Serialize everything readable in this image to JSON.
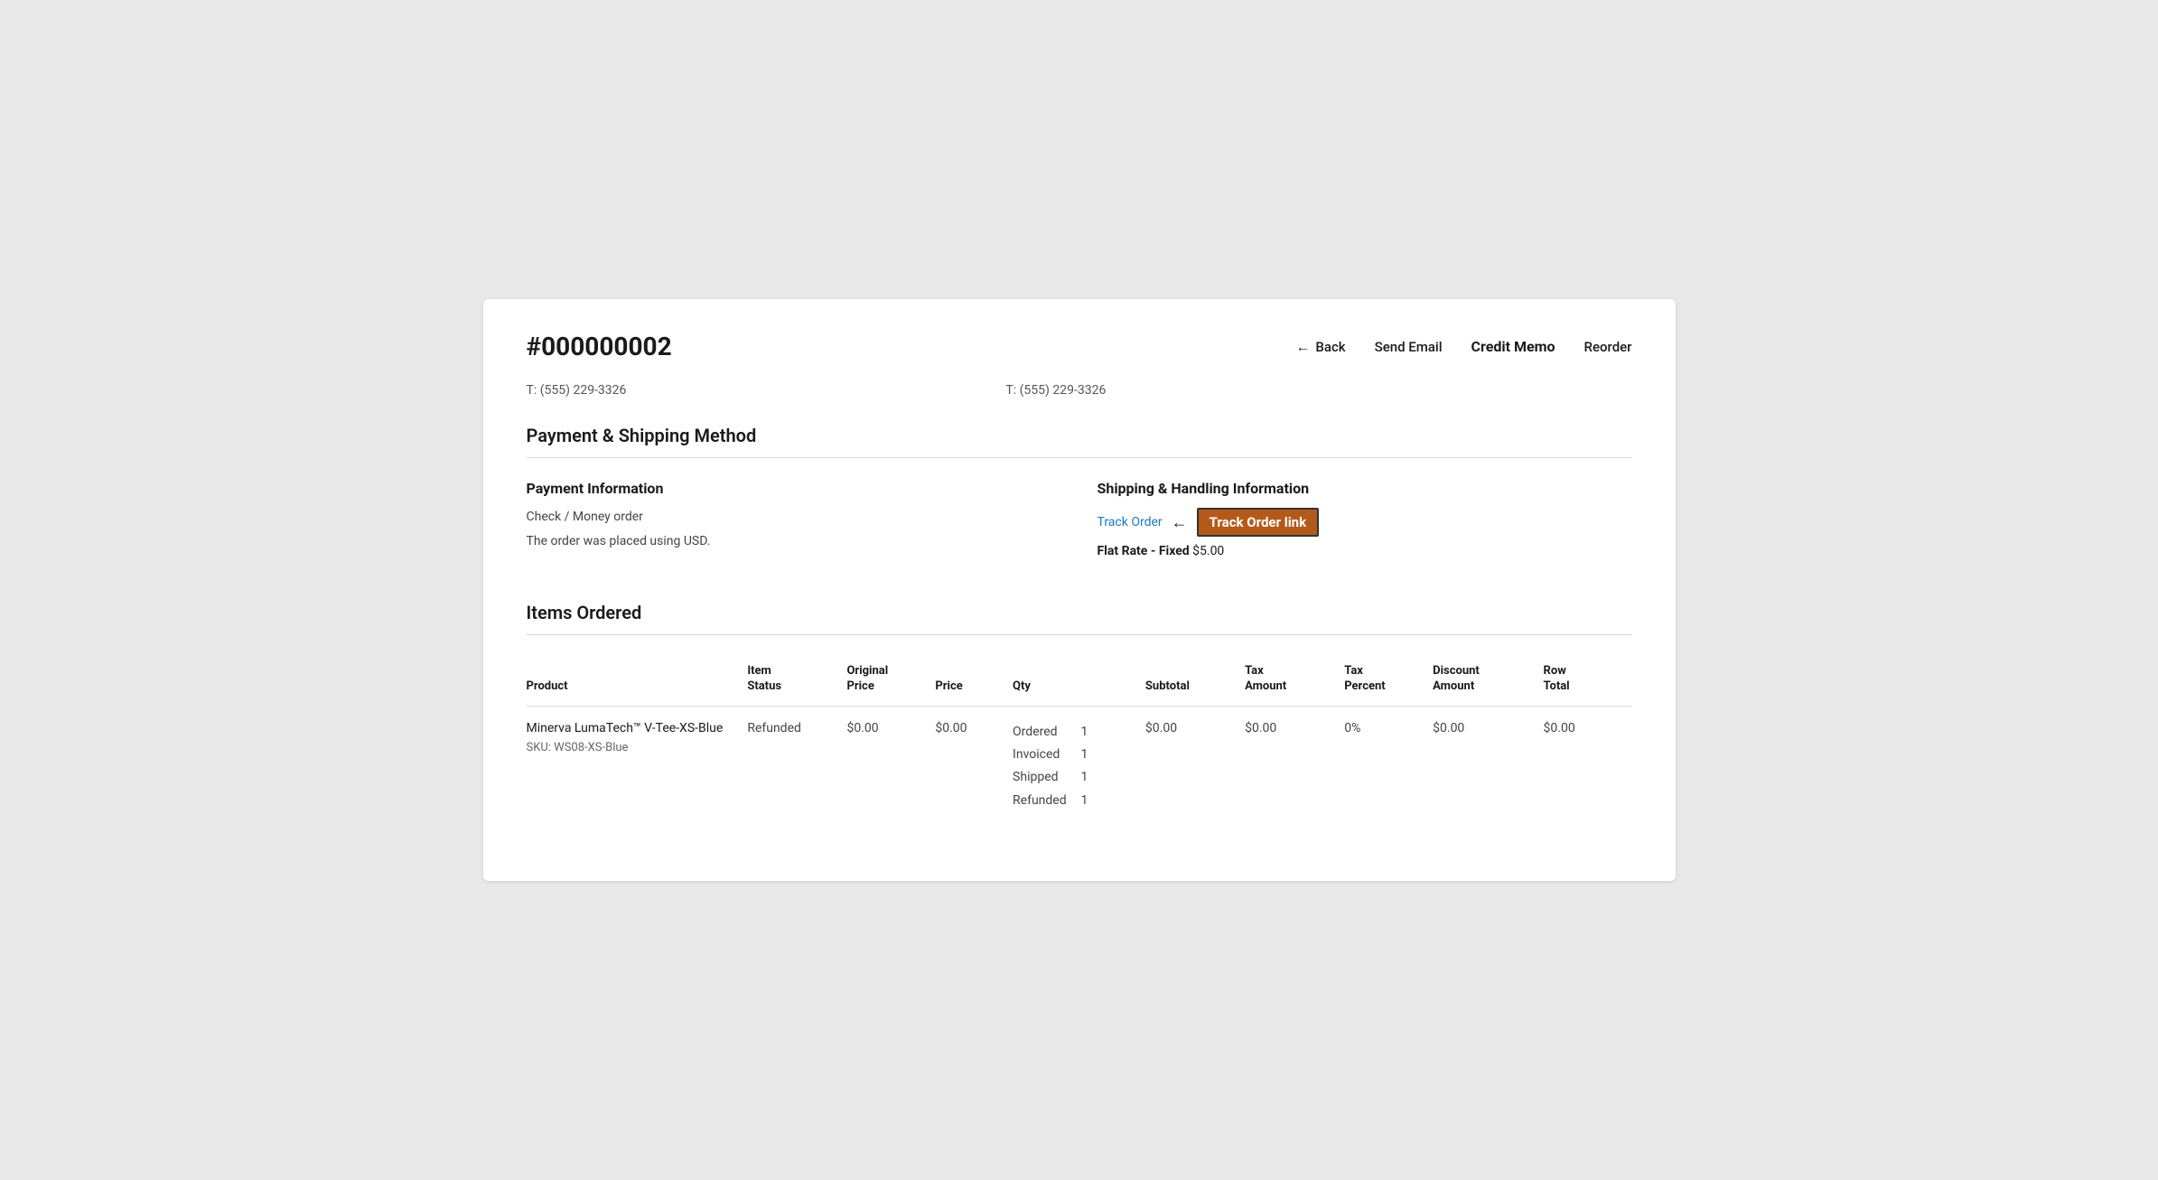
{
  "header": {
    "order_id": "#000000002",
    "actions": {
      "back_label": "Back",
      "send_email_label": "Send Email",
      "credit_memo_label": "Credit Memo",
      "reorder_label": "Reorder"
    }
  },
  "phone_numbers": {
    "left": "T: (555) 229-3326",
    "right": "T: (555) 229-3326"
  },
  "payment_section": {
    "title": "Payment & Shipping Method",
    "payment_info": {
      "title": "Payment Information",
      "method": "Check / Money order",
      "currency_note": "The order was placed using USD."
    },
    "shipping_info": {
      "title": "Shipping & Handling Information",
      "track_order_label": "Track Order",
      "track_order_annotation": "Track Order link",
      "flat_rate_label": "Flat Rate - Fixed",
      "flat_rate_value": "$5.00"
    }
  },
  "items_section": {
    "title": "Items Ordered",
    "columns": {
      "product": "Product",
      "item_status": "Item\nStatus",
      "original_price": "Original\nPrice",
      "price": "Price",
      "qty": "Qty",
      "subtotal": "Subtotal",
      "tax_amount": "Tax\nAmount",
      "tax_percent": "Tax\nPercent",
      "discount_amount": "Discount\nAmount",
      "row_total": "Row\nTotal"
    },
    "rows": [
      {
        "product_name": "Minerva LumaTech™ V-Tee-XS-Blue",
        "sku": "SKU: WS08-XS-Blue",
        "item_status": "Refunded",
        "original_price": "$0.00",
        "price": "$0.00",
        "qty": [
          {
            "label": "Ordered",
            "value": "1"
          },
          {
            "label": "Invoiced",
            "value": "1"
          },
          {
            "label": "Shipped",
            "value": "1"
          },
          {
            "label": "Refunded",
            "value": "1"
          }
        ],
        "subtotal": "$0.00",
        "tax_amount": "$0.00",
        "tax_percent": "0%",
        "discount_amount": "$0.00",
        "row_total": "$0.00"
      }
    ]
  }
}
